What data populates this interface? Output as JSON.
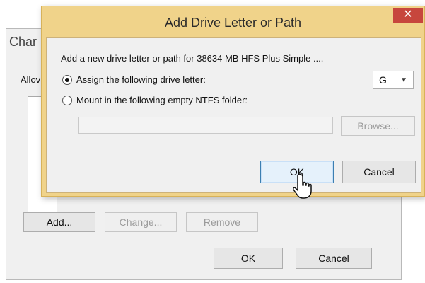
{
  "background_dialog": {
    "title_partial": "Char",
    "group_label_partial": "Allov",
    "buttons": {
      "add": "Add...",
      "change": "Change...",
      "remove": "Remove",
      "ok": "OK",
      "cancel": "Cancel"
    }
  },
  "dialog": {
    "title": "Add Drive Letter or Path",
    "close_glyph": "✕",
    "description": "Add a new drive letter or path for 38634 MB HFS Plus Simple ....",
    "option_assign": "Assign the following drive letter:",
    "option_mount": "Mount in the following empty NTFS folder:",
    "selected_option": "assign",
    "drive_letter": "G",
    "folder_value": "",
    "buttons": {
      "browse": "Browse...",
      "ok": "OK",
      "cancel": "Cancel"
    }
  },
  "colors": {
    "titlebar": "#f0d38a",
    "close": "#c7463d",
    "default_button_border": "#3c7fb1"
  },
  "icons": {
    "close": "close-icon",
    "dropdown": "chevron-down-icon",
    "cursor": "hand-pointer-icon"
  }
}
